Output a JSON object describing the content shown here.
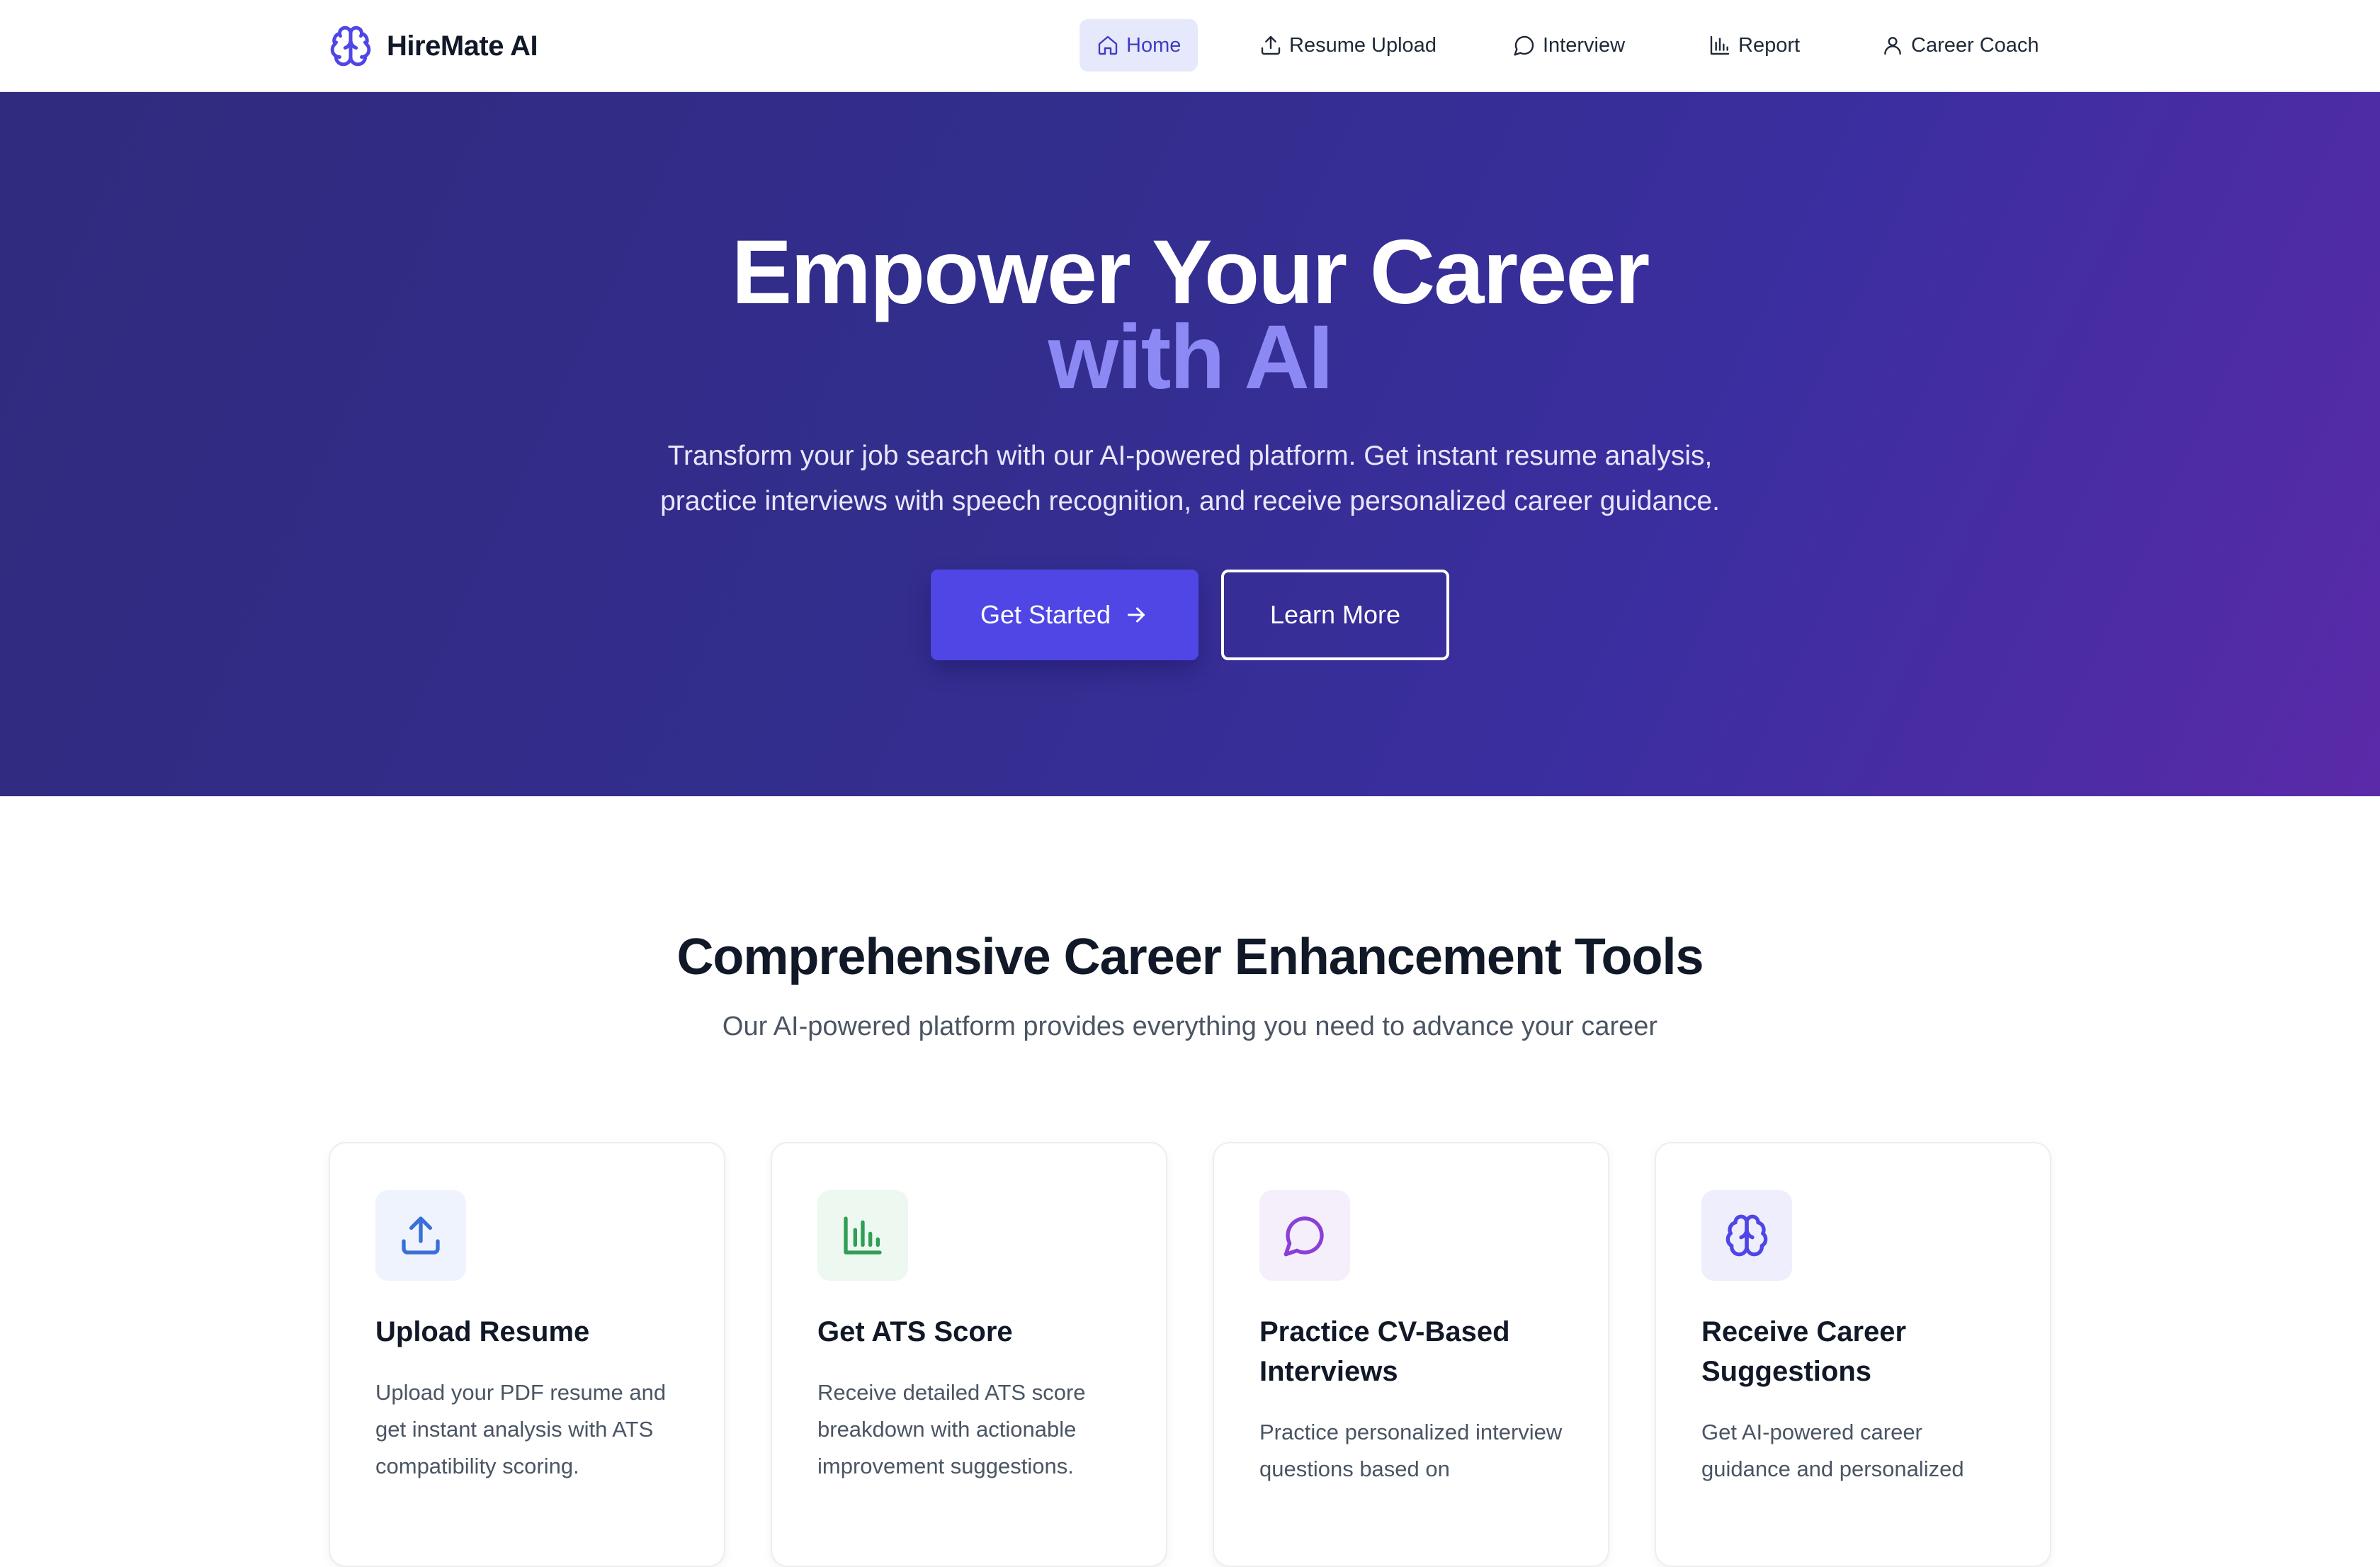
{
  "brand": {
    "name": "HireMate AI",
    "icon": "brain-icon",
    "accent": "#4f46e5"
  },
  "nav": {
    "items": [
      {
        "label": "Home",
        "icon": "home-icon",
        "active": true
      },
      {
        "label": "Resume Upload",
        "icon": "upload-icon",
        "active": false
      },
      {
        "label": "Interview",
        "icon": "chat-icon",
        "active": false
      },
      {
        "label": "Report",
        "icon": "bar-chart-icon",
        "active": false
      },
      {
        "label": "Career Coach",
        "icon": "user-icon",
        "active": false
      }
    ]
  },
  "hero": {
    "title_line1": "Empower Your Career",
    "title_line2": "with AI",
    "description": "Transform your job search with our AI-powered platform. Get instant resume analysis, practice interviews with speech recognition, and receive personalized career guidance.",
    "primary_button": "Get Started",
    "secondary_button": "Learn More",
    "colors": {
      "gradient_start": "#2f2b7d",
      "gradient_end": "#5a2aa9",
      "highlight": "#8d89f4"
    }
  },
  "features": {
    "title": "Comprehensive Career Enhancement Tools",
    "subtitle": "Our AI-powered platform provides everything you need to advance your career",
    "cards": [
      {
        "title": "Upload Resume",
        "description": "Upload your PDF resume and get instant analysis with ATS compatibility scoring.",
        "icon": "upload-icon",
        "color": "#3b6fd8"
      },
      {
        "title": "Get ATS Score",
        "description": "Receive detailed ATS score breakdown with actionable improvement suggestions.",
        "icon": "bar-chart-icon",
        "color": "#2f9e57"
      },
      {
        "title": "Practice CV-Based Interviews",
        "description": "Practice personalized interview questions based on",
        "icon": "chat-icon",
        "color": "#8b3fd6"
      },
      {
        "title": "Receive Career Suggestions",
        "description": "Get AI-powered career guidance and personalized",
        "icon": "brain-icon",
        "color": "#4f46e5"
      }
    ]
  }
}
